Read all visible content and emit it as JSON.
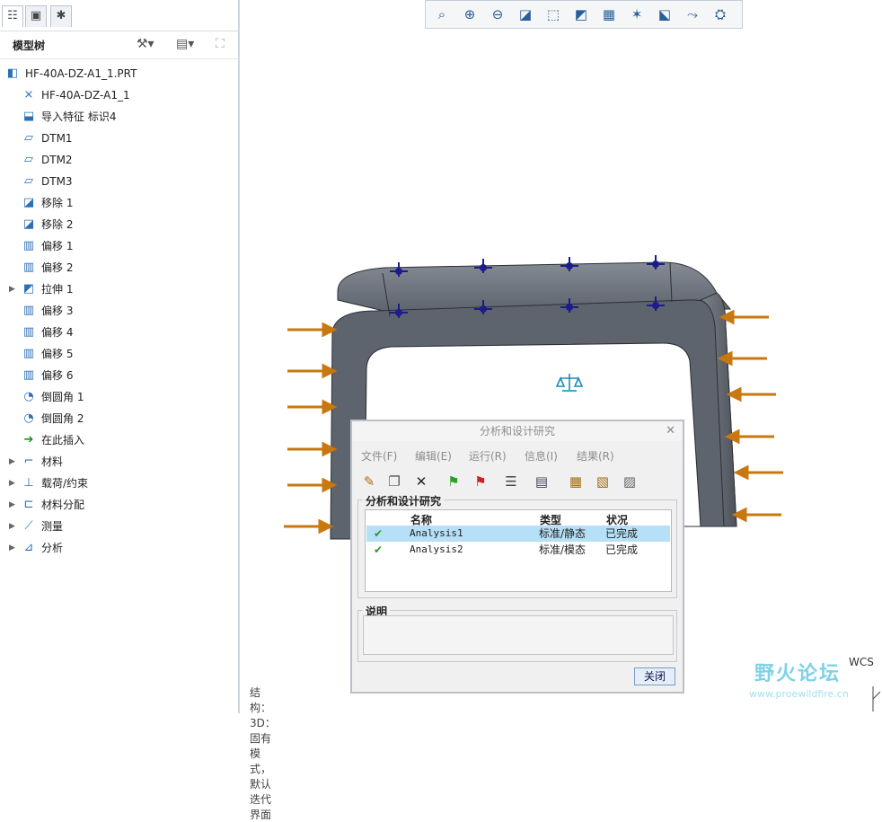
{
  "tree_title": "模型树",
  "tree_items": [
    {
      "label": "HF-40A-DZ-A1_1.PRT",
      "icon": "part-icon",
      "indent": 0,
      "expand": ""
    },
    {
      "label": "HF-40A-DZ-A1_1",
      "icon": "csys-icon",
      "indent": 1,
      "expand": ""
    },
    {
      "label": "导入特征 标识4",
      "icon": "import-feature-icon",
      "indent": 1,
      "expand": ""
    },
    {
      "label": "DTM1",
      "icon": "datum-plane-icon",
      "indent": 1,
      "expand": ""
    },
    {
      "label": "DTM2",
      "icon": "datum-plane-icon",
      "indent": 1,
      "expand": ""
    },
    {
      "label": "DTM3",
      "icon": "datum-plane-icon",
      "indent": 1,
      "expand": ""
    },
    {
      "label": "移除 1",
      "icon": "remove-icon",
      "indent": 1,
      "expand": ""
    },
    {
      "label": "移除 2",
      "icon": "remove-icon",
      "indent": 1,
      "expand": ""
    },
    {
      "label": "偏移 1",
      "icon": "offset-icon",
      "indent": 1,
      "expand": ""
    },
    {
      "label": "偏移 2",
      "icon": "offset-icon",
      "indent": 1,
      "expand": ""
    },
    {
      "label": "拉伸 1",
      "icon": "extrude-icon",
      "indent": 1,
      "expand": "▶"
    },
    {
      "label": "偏移 3",
      "icon": "offset-icon",
      "indent": 1,
      "expand": ""
    },
    {
      "label": "偏移 4",
      "icon": "offset-icon",
      "indent": 1,
      "expand": ""
    },
    {
      "label": "偏移 5",
      "icon": "offset-icon",
      "indent": 1,
      "expand": ""
    },
    {
      "label": "偏移 6",
      "icon": "offset-icon",
      "indent": 1,
      "expand": ""
    },
    {
      "label": "倒圆角 1",
      "icon": "round-icon",
      "indent": 1,
      "expand": ""
    },
    {
      "label": "倒圆角 2",
      "icon": "round-icon",
      "indent": 1,
      "expand": ""
    },
    {
      "label": "在此插入",
      "icon": "insert-here-icon",
      "indent": 1,
      "expand": ""
    },
    {
      "label": "材料",
      "icon": "material-icon",
      "indent": 1,
      "expand": "▶"
    },
    {
      "label": "载荷/约束",
      "icon": "load-constraint-icon",
      "indent": 1,
      "expand": "▶"
    },
    {
      "label": "材料分配",
      "icon": "material-assign-icon",
      "indent": 1,
      "expand": "▶"
    },
    {
      "label": "测量",
      "icon": "measure-icon",
      "indent": 1,
      "expand": "▶"
    },
    {
      "label": "分析",
      "icon": "analysis-icon",
      "indent": 1,
      "expand": "▶"
    }
  ],
  "status_text": "结构：3D：固有模式，默认迭代界面",
  "dialog": {
    "title": "分析和设计研究",
    "menus": [
      "文件(F)",
      "编辑(E)",
      "运行(R)",
      "信息(I)",
      "结果(R)"
    ],
    "group1_label": "分析和设计研究",
    "columns": [
      "名称",
      "类型",
      "状况"
    ],
    "rows": [
      {
        "check": "✔",
        "name": "Analysis1",
        "type": "标准/静态",
        "status": "已完成",
        "selected": true
      },
      {
        "check": "✔",
        "name": "Analysis2",
        "type": "标准/模态",
        "status": "已完成",
        "selected": false
      }
    ],
    "group2_label": "说明",
    "close_label": "关闭"
  },
  "watermark": {
    "title": "野火论坛",
    "url": "www.proewildfire.cn"
  },
  "wcs_label": "WCS",
  "colors": {
    "model_fill": "#5e646e",
    "arrow": "#c8780e",
    "constraint": "#1c1c8c",
    "selection": "#b6e0f7"
  }
}
